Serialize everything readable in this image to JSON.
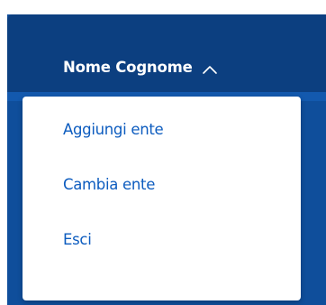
{
  "header": {
    "user_name": "Nome Cognome",
    "toggle_icon": "chevron-up-icon"
  },
  "dropdown": {
    "items": [
      {
        "label": "Aggiungi ente"
      },
      {
        "label": "Cambia ente"
      },
      {
        "label": "Esci"
      }
    ]
  },
  "colors": {
    "header_bg": "#0c3f80",
    "nav_bg": "#0f4e9b",
    "link": "#0d5cbf",
    "dropdown_bg": "#ffffff"
  }
}
